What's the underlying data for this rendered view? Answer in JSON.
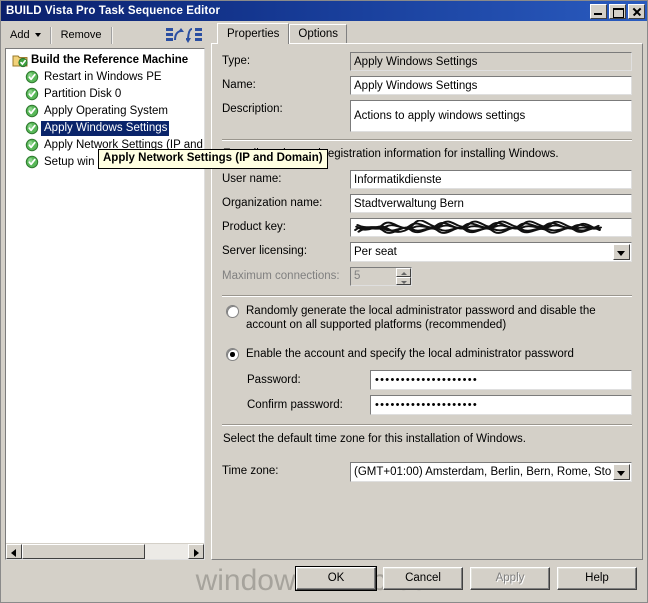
{
  "window": {
    "title": "BUILD Vista Pro Task Sequence Editor",
    "minimize_label": "Minimize",
    "maximize_label": "Maximize",
    "close_label": "Close"
  },
  "toolbar": {
    "add_label": "Add",
    "remove_label": "Remove",
    "move_up_label": "Move Up",
    "move_down_label": "Move Down"
  },
  "tree": {
    "root": "Build the Reference Machine",
    "items": [
      "Restart in Windows PE",
      "Partition Disk 0",
      "Apply Operating System",
      "Apply Windows Settings",
      "Apply Network Settings (IP and",
      "Setup win"
    ],
    "selected": "Apply Windows Settings"
  },
  "tooltip": {
    "text": "Apply Network Settings (IP and Domain)"
  },
  "tabs": [
    {
      "label": "Properties",
      "active": true
    },
    {
      "label": "Options",
      "active": false
    }
  ],
  "form": {
    "type_label": "Type:",
    "type_value": "Apply Windows Settings",
    "name_label": "Name:",
    "name_value": "Apply Windows Settings",
    "description_label": "Description:",
    "description_value": "Actions to apply windows settings",
    "license_help": "Enter licensing and registration information for installing Windows.",
    "user_name_label": "User name:",
    "user_name_value": "Informatikdienste",
    "organization_label": "Organization name:",
    "organization_value": "Stadtverwaltung Bern",
    "product_key_label": "Product key:",
    "product_key_value": "",
    "server_licensing_label": "Server licensing:",
    "server_licensing_value": "Per seat",
    "max_connections_label": "Maximum connections:",
    "max_connections_value": "5"
  },
  "admin": {
    "random_password_option": "Randomly generate the local administrator password and disable the account on all supported platforms (recommended)",
    "enable_account_option": "Enable the account and specify the local administrator password",
    "selected_option": "enable_account",
    "password_label": "Password:",
    "password_value": "••••••••••••••••••••",
    "confirm_password_label": "Confirm password:",
    "confirm_password_value": "••••••••••••••••••••"
  },
  "timezone": {
    "help": "Select the default time zone for this installation of Windows.",
    "label": "Time zone:",
    "value": "(GMT+01:00) Amsterdam, Berlin, Bern, Rome, Sto"
  },
  "buttons": {
    "ok": "OK",
    "cancel": "Cancel",
    "apply": "Apply",
    "help": "Help"
  },
  "watermark": {
    "text": "windows-noob.com"
  },
  "colors": {
    "titlebar_start": "#0a1f6b",
    "titlebar_end": "#2a5bbf",
    "face": "#d4d0c8",
    "selection": "#0a246a",
    "tooltip_bg": "#ffffe1",
    "status_green": "#3ea13e"
  }
}
